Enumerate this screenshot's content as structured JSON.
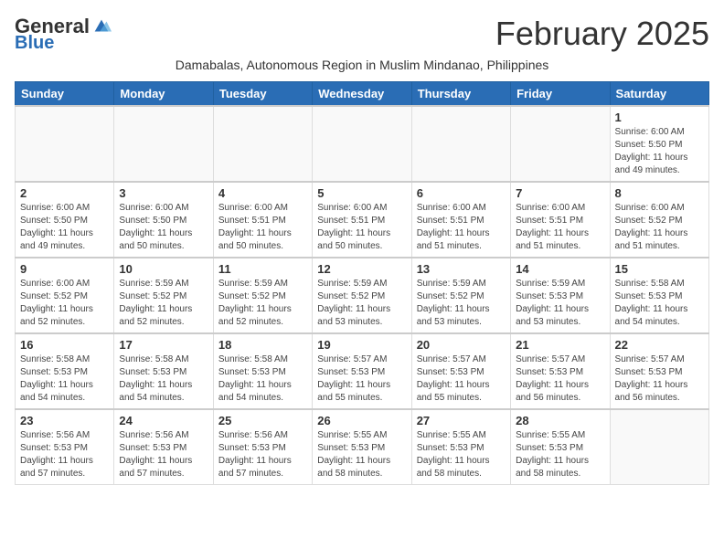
{
  "header": {
    "logo_general": "General",
    "logo_blue": "Blue",
    "month_title": "February 2025",
    "subtitle": "Damabalas, Autonomous Region in Muslim Mindanao, Philippines"
  },
  "days_of_week": [
    "Sunday",
    "Monday",
    "Tuesday",
    "Wednesday",
    "Thursday",
    "Friday",
    "Saturday"
  ],
  "weeks": [
    [
      {
        "day": "",
        "info": ""
      },
      {
        "day": "",
        "info": ""
      },
      {
        "day": "",
        "info": ""
      },
      {
        "day": "",
        "info": ""
      },
      {
        "day": "",
        "info": ""
      },
      {
        "day": "",
        "info": ""
      },
      {
        "day": "1",
        "info": "Sunrise: 6:00 AM\nSunset: 5:50 PM\nDaylight: 11 hours\nand 49 minutes."
      }
    ],
    [
      {
        "day": "2",
        "info": "Sunrise: 6:00 AM\nSunset: 5:50 PM\nDaylight: 11 hours\nand 49 minutes."
      },
      {
        "day": "3",
        "info": "Sunrise: 6:00 AM\nSunset: 5:50 PM\nDaylight: 11 hours\nand 50 minutes."
      },
      {
        "day": "4",
        "info": "Sunrise: 6:00 AM\nSunset: 5:51 PM\nDaylight: 11 hours\nand 50 minutes."
      },
      {
        "day": "5",
        "info": "Sunrise: 6:00 AM\nSunset: 5:51 PM\nDaylight: 11 hours\nand 50 minutes."
      },
      {
        "day": "6",
        "info": "Sunrise: 6:00 AM\nSunset: 5:51 PM\nDaylight: 11 hours\nand 51 minutes."
      },
      {
        "day": "7",
        "info": "Sunrise: 6:00 AM\nSunset: 5:51 PM\nDaylight: 11 hours\nand 51 minutes."
      },
      {
        "day": "8",
        "info": "Sunrise: 6:00 AM\nSunset: 5:52 PM\nDaylight: 11 hours\nand 51 minutes."
      }
    ],
    [
      {
        "day": "9",
        "info": "Sunrise: 6:00 AM\nSunset: 5:52 PM\nDaylight: 11 hours\nand 52 minutes."
      },
      {
        "day": "10",
        "info": "Sunrise: 5:59 AM\nSunset: 5:52 PM\nDaylight: 11 hours\nand 52 minutes."
      },
      {
        "day": "11",
        "info": "Sunrise: 5:59 AM\nSunset: 5:52 PM\nDaylight: 11 hours\nand 52 minutes."
      },
      {
        "day": "12",
        "info": "Sunrise: 5:59 AM\nSunset: 5:52 PM\nDaylight: 11 hours\nand 53 minutes."
      },
      {
        "day": "13",
        "info": "Sunrise: 5:59 AM\nSunset: 5:52 PM\nDaylight: 11 hours\nand 53 minutes."
      },
      {
        "day": "14",
        "info": "Sunrise: 5:59 AM\nSunset: 5:53 PM\nDaylight: 11 hours\nand 53 minutes."
      },
      {
        "day": "15",
        "info": "Sunrise: 5:58 AM\nSunset: 5:53 PM\nDaylight: 11 hours\nand 54 minutes."
      }
    ],
    [
      {
        "day": "16",
        "info": "Sunrise: 5:58 AM\nSunset: 5:53 PM\nDaylight: 11 hours\nand 54 minutes."
      },
      {
        "day": "17",
        "info": "Sunrise: 5:58 AM\nSunset: 5:53 PM\nDaylight: 11 hours\nand 54 minutes."
      },
      {
        "day": "18",
        "info": "Sunrise: 5:58 AM\nSunset: 5:53 PM\nDaylight: 11 hours\nand 54 minutes."
      },
      {
        "day": "19",
        "info": "Sunrise: 5:57 AM\nSunset: 5:53 PM\nDaylight: 11 hours\nand 55 minutes."
      },
      {
        "day": "20",
        "info": "Sunrise: 5:57 AM\nSunset: 5:53 PM\nDaylight: 11 hours\nand 55 minutes."
      },
      {
        "day": "21",
        "info": "Sunrise: 5:57 AM\nSunset: 5:53 PM\nDaylight: 11 hours\nand 56 minutes."
      },
      {
        "day": "22",
        "info": "Sunrise: 5:57 AM\nSunset: 5:53 PM\nDaylight: 11 hours\nand 56 minutes."
      }
    ],
    [
      {
        "day": "23",
        "info": "Sunrise: 5:56 AM\nSunset: 5:53 PM\nDaylight: 11 hours\nand 57 minutes."
      },
      {
        "day": "24",
        "info": "Sunrise: 5:56 AM\nSunset: 5:53 PM\nDaylight: 11 hours\nand 57 minutes."
      },
      {
        "day": "25",
        "info": "Sunrise: 5:56 AM\nSunset: 5:53 PM\nDaylight: 11 hours\nand 57 minutes."
      },
      {
        "day": "26",
        "info": "Sunrise: 5:55 AM\nSunset: 5:53 PM\nDaylight: 11 hours\nand 58 minutes."
      },
      {
        "day": "27",
        "info": "Sunrise: 5:55 AM\nSunset: 5:53 PM\nDaylight: 11 hours\nand 58 minutes."
      },
      {
        "day": "28",
        "info": "Sunrise: 5:55 AM\nSunset: 5:53 PM\nDaylight: 11 hours\nand 58 minutes."
      },
      {
        "day": "",
        "info": ""
      }
    ]
  ]
}
